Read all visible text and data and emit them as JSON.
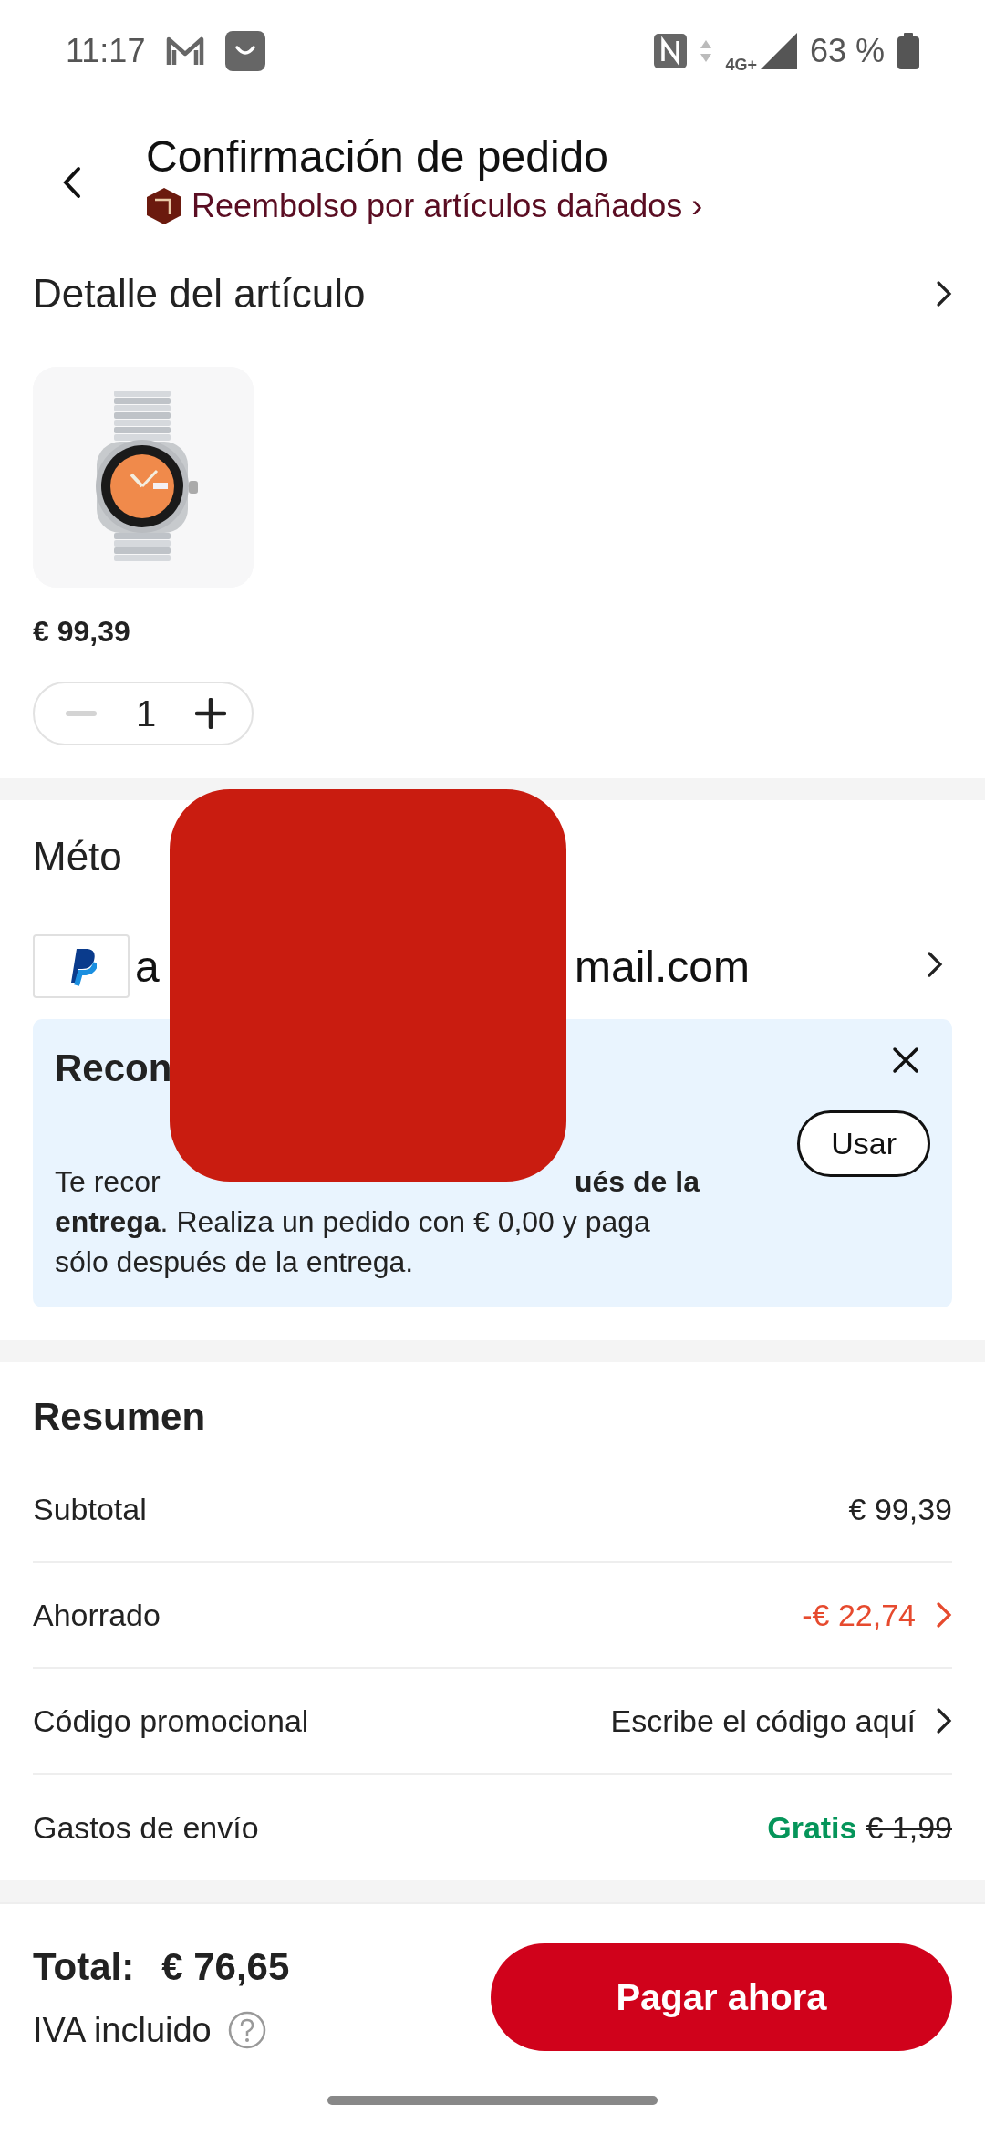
{
  "status_bar": {
    "time": "11:17",
    "network": "4G+",
    "battery": "63 %"
  },
  "header": {
    "title": "Confirmación de pedido",
    "subtitle": "Reembolso por artículos dañados ›"
  },
  "item_detail": {
    "title": "Detalle del artículo",
    "price": "€ 99,39",
    "quantity": "1",
    "decrease_disabled": true
  },
  "payment": {
    "title": "Méto",
    "account_start": "a",
    "account_end": "mail.com"
  },
  "recommendation": {
    "title": "Recon",
    "line_start": "Te recor",
    "line_end": "**ués de la**",
    "text": "**entrega**. Realiza un pedido con € 0,00 y paga sólo después de la entrega.",
    "button": "Usar"
  },
  "summary": {
    "title": "Resumen",
    "rows": [
      {
        "kind": "plain",
        "label": "Subtotal",
        "value": "€ 99,39"
      },
      {
        "kind": "discount",
        "label": "Ahorrado",
        "value": "-€ 22,74"
      },
      {
        "kind": "link",
        "label": "Código promocional",
        "value": "Escribe el código aquí"
      },
      {
        "kind": "free",
        "label": "Gastos de envío",
        "value": "Gratis",
        "old_value": "€ 1,99"
      }
    ]
  },
  "footer": {
    "total_label": "Total:",
    "total": "€ 76,65",
    "tax_note": "IVA incluido",
    "pay_button": "Pagar ahora"
  }
}
